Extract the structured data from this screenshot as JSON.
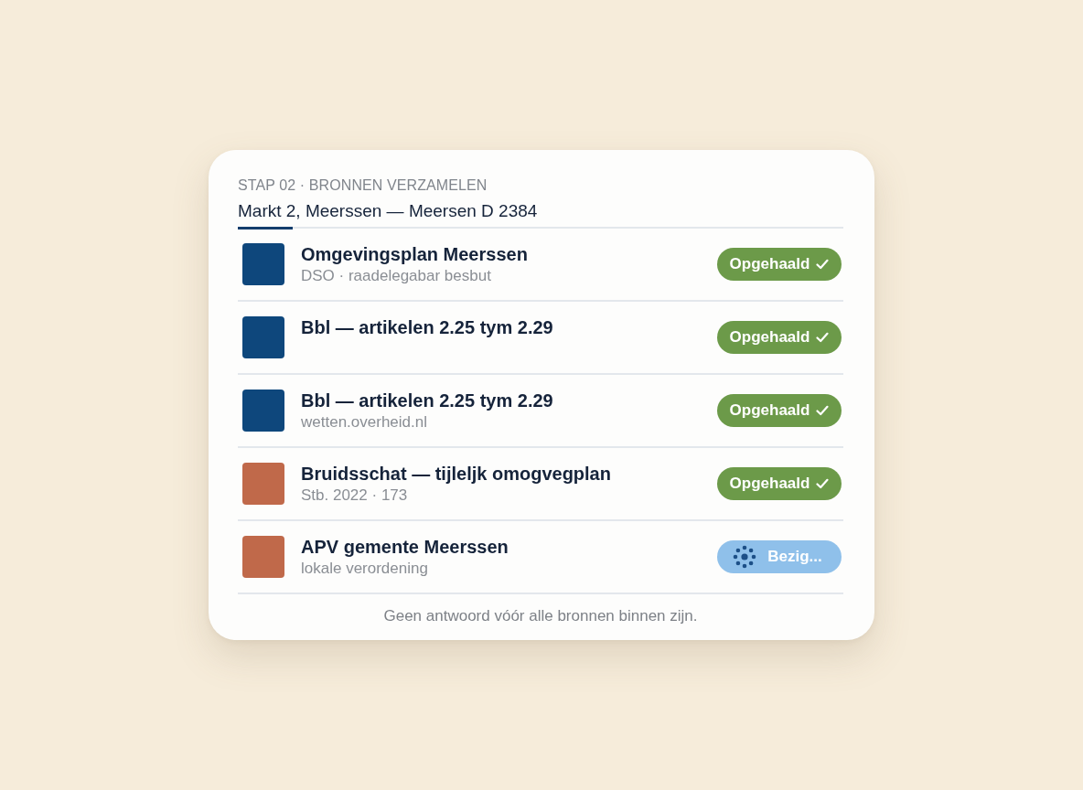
{
  "header": {
    "step": "STAP 02 · BRONNEN VERZAMELEN",
    "title": "Markt 2, Meerssen — Meersen D 2384"
  },
  "sources": [
    {
      "title": "Omgevingsplan Meerssen",
      "subtitle": "DSO · raadelegabar besbut",
      "color": "#0e477c",
      "status": {
        "kind": "done",
        "label": "Opgehaald"
      }
    },
    {
      "title": "Bbl — artikelen 2.25 tym 2.29",
      "color": "#0e477c",
      "status": {
        "kind": "done",
        "label": "Opgehaald"
      }
    },
    {
      "title": "Bbl — artikelen 2.25 tym 2.29",
      "subtitle": "wetten.overheid.nl",
      "color": "#0e477c",
      "status": {
        "kind": "done",
        "label": "Opgehaald"
      }
    },
    {
      "title": "Bruidsschat — tijleljk omogvegplan",
      "subtitle": "Stb. 2022 · 173",
      "color": "#c0694a",
      "status": {
        "kind": "done",
        "label": "Opgehaald"
      }
    },
    {
      "title": "APV gemente Meerssen",
      "subtitle": "lokale verordening",
      "color": "#c0694a",
      "status": {
        "kind": "busy",
        "label": "Bezig..."
      }
    }
  ],
  "footer": "Geen antwoord vóór alle bronnen binnen zijn."
}
